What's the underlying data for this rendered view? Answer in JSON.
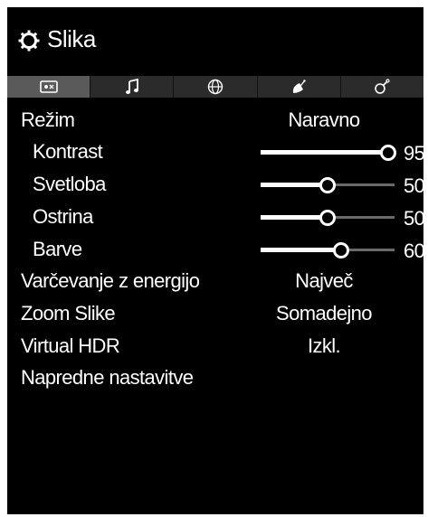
{
  "title": "Slika",
  "tabs": [
    {
      "icon": "picture-tab-icon",
      "active": true
    },
    {
      "icon": "music-note-icon",
      "active": false
    },
    {
      "icon": "globe-icon",
      "active": false
    },
    {
      "icon": "satellite-dish-icon",
      "active": false
    },
    {
      "icon": "settings-tools-icon",
      "active": false
    }
  ],
  "menu": {
    "rezim": {
      "label": "Režim",
      "value": "Naravno"
    },
    "kontrast": {
      "label": "Kontrast",
      "value": 95
    },
    "svetloba": {
      "label": "Svetloba",
      "value": 50
    },
    "ostrina": {
      "label": "Ostrina",
      "value": 50
    },
    "barve": {
      "label": "Barve",
      "value": 60
    },
    "energija": {
      "label": "Varčevanje z energijo",
      "value": "Največ"
    },
    "zoom": {
      "label": "Zoom Slike",
      "value": "Somadejno"
    },
    "hdr": {
      "label": "Virtual HDR",
      "value": "Izkl."
    },
    "napredne": {
      "label": "Napredne nastavitve"
    }
  }
}
